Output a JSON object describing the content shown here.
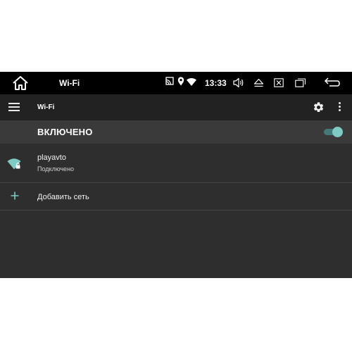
{
  "status_bar": {
    "title": "Wi-Fi",
    "time": "13:33",
    "icons": [
      "home-icon",
      "cast-icon",
      "location-icon",
      "wifi-signal-icon",
      "volume-icon",
      "eject-icon",
      "close-window-icon",
      "recent-apps-icon",
      "back-icon"
    ]
  },
  "app_bar": {
    "title": "Wi-Fi",
    "icons": [
      "menu-icon",
      "gear-icon",
      "more-vert-icon"
    ]
  },
  "master_switch": {
    "label": "ВКЛЮЧЕНО",
    "on": true
  },
  "networks": [
    {
      "ssid": "playavto",
      "status": "Подключено",
      "icon": "wifi-lock-icon"
    }
  ],
  "add_network": {
    "label": "Добавить сеть",
    "icon": "plus-icon"
  },
  "colors": {
    "accent": "#7fcbc4",
    "toolbar": "#222222",
    "background": "#2e2e2e",
    "status_bar": "#000000"
  }
}
